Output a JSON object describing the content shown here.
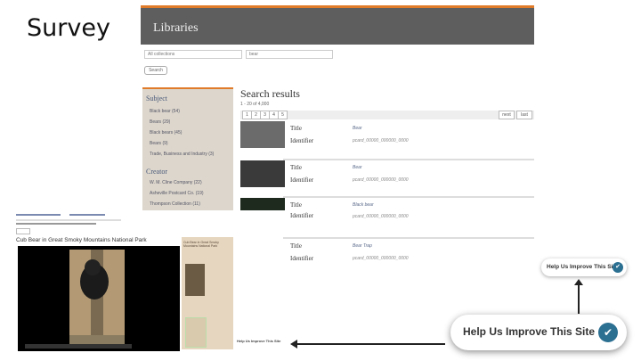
{
  "slide": {
    "title": "Survey"
  },
  "libraries": {
    "header_title": "Libraries",
    "collection_select": "All collections",
    "query": "bear",
    "search_label": "Search",
    "subject_heading": "Subject",
    "subjects": [
      {
        "label": "Black bear (54)"
      },
      {
        "label": "Bears (29)"
      },
      {
        "label": "Black bears (45)"
      },
      {
        "label": "Bears (9)"
      },
      {
        "label": "Trade, Business and Industry (3)"
      }
    ],
    "creator_heading": "Creator",
    "creators": [
      {
        "label": "W. M. Cline Company (22)"
      },
      {
        "label": "Asheville Postcard Co. (19)"
      },
      {
        "label": "Thompson Collection (11)"
      }
    ],
    "results_title": "Search results",
    "results_count": "1 - 20 of 4,000",
    "pages": [
      "1",
      "2",
      "3",
      "4",
      "5"
    ],
    "page_next": "next",
    "page_last": "last",
    "results": [
      {
        "title_label": "Title",
        "title": "Bear",
        "id_label": "Identifier",
        "id": "pcard_00000_000000_0000"
      },
      {
        "title_label": "Title",
        "title": "Bear",
        "id_label": "Identifier",
        "id": "pcard_00000_000000_0000"
      },
      {
        "title_label": "Title",
        "title": "Black bear",
        "id_label": "Identifier",
        "id": "pcard_00000_000000_0000"
      },
      {
        "title_label": "Title",
        "title": "Bear Trap",
        "id_label": "Identifier",
        "id": "pcard_00000_000000_0000"
      }
    ]
  },
  "item_page": {
    "title": "Cub Bear in Great Smoky Mountains National Park",
    "side_title": "Cub Bear in Great Smoky Mountains National Park"
  },
  "help": {
    "label": "Help Us Improve This Site",
    "accent": "#2b6f91"
  },
  "colors": {
    "orange": "#e07b2a",
    "header_gray": "#5e5e5e"
  }
}
